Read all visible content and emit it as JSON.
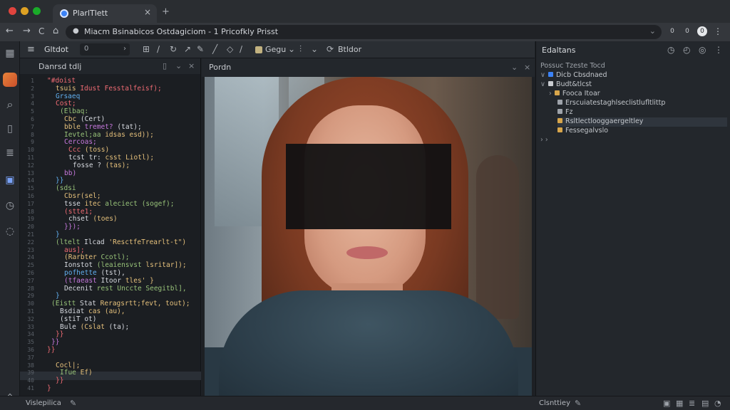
{
  "browser": {
    "tab_title": "PlarlTlett",
    "tab_close": "×",
    "new_tab": "+",
    "nav": {
      "back": "←",
      "forward": "→",
      "reload": "C",
      "home": "⌂"
    },
    "url": "Miacm Bsinabicos Ostdagiciom - 1 Pricofkly Prisst",
    "extensions": [
      "0",
      "0",
      "0",
      "⋮"
    ]
  },
  "activity_bar": {
    "icons": [
      "layout-icon",
      "avatar",
      "search-icon",
      "file-icon",
      "layers-icon",
      "image-icon",
      "history-icon",
      "settings-icon"
    ]
  },
  "toolbar": {
    "title": "Gltdot",
    "select_value": "0",
    "label_1": "Gegu",
    "label_2": "Btldor"
  },
  "code_panel": {
    "title": "Danrsd tdlj",
    "lines": [
      {
        "n": "1",
        "indent": 3,
        "parts": [
          [
            "c-red",
            "\"#doist"
          ]
        ]
      },
      {
        "n": "2",
        "indent": 5,
        "parts": [
          [
            "c-yellow",
            "tsuis "
          ],
          [
            "c-red",
            "Idust Fesstalfeisf);"
          ]
        ]
      },
      {
        "n": "3",
        "indent": 5,
        "parts": [
          [
            "c-blue",
            "Grsaeq"
          ]
        ]
      },
      {
        "n": "4",
        "indent": 5,
        "parts": [
          [
            "c-red",
            "Cost;"
          ]
        ]
      },
      {
        "n": "5",
        "indent": 6,
        "parts": [
          [
            "c-green",
            "(Elbaq:"
          ]
        ]
      },
      {
        "n": "6",
        "indent": 7,
        "parts": [
          [
            "c-yellow",
            "Cbc "
          ],
          [
            "c-white",
            "(Cert)"
          ]
        ]
      },
      {
        "n": "7",
        "indent": 7,
        "parts": [
          [
            "c-yellow",
            "bble "
          ],
          [
            "c-purple",
            "tremet? "
          ],
          [
            "c-white",
            "(tat);"
          ]
        ]
      },
      {
        "n": "8",
        "indent": 7,
        "parts": [
          [
            "c-green",
            "Ievtel;aa "
          ],
          [
            "c-yellow",
            "idsas esd));"
          ]
        ]
      },
      {
        "n": "9",
        "indent": 7,
        "parts": [
          [
            "c-purple",
            "Cercoas;"
          ]
        ]
      },
      {
        "n": "10",
        "indent": 8,
        "parts": [
          [
            "c-red",
            "Ccc "
          ],
          [
            "c-yellow",
            "(toss)"
          ]
        ]
      },
      {
        "n": "11",
        "indent": 8,
        "parts": [
          [
            "c-white",
            "tcst tr: "
          ],
          [
            "c-yellow",
            "csst Liotl);"
          ]
        ]
      },
      {
        "n": "12",
        "indent": 9,
        "parts": [
          [
            "c-white",
            "fosse ? "
          ],
          [
            "c-yellow",
            "(tas);"
          ]
        ]
      },
      {
        "n": "13",
        "indent": 7,
        "parts": [
          [
            "c-purple",
            "bb)"
          ]
        ]
      },
      {
        "n": "14",
        "indent": 5,
        "parts": [
          [
            "c-blue",
            "}}"
          ]
        ]
      },
      {
        "n": "15",
        "indent": 5,
        "parts": [
          [
            "c-green",
            "(sdsi"
          ]
        ]
      },
      {
        "n": "16",
        "indent": 7,
        "parts": [
          [
            "c-yellow",
            "Cbsr(sel;"
          ]
        ]
      },
      {
        "n": "17",
        "indent": 7,
        "parts": [
          [
            "c-white",
            "tsse "
          ],
          [
            "c-yellow",
            "itec "
          ],
          [
            "c-green",
            "aleciect (sogef);"
          ]
        ]
      },
      {
        "n": "18",
        "indent": 7,
        "parts": [
          [
            "c-red",
            "(stte1;"
          ]
        ]
      },
      {
        "n": "19",
        "indent": 8,
        "parts": [
          [
            "c-white",
            "chset "
          ],
          [
            "c-yellow",
            "(toes)"
          ]
        ]
      },
      {
        "n": "20",
        "indent": 7,
        "parts": [
          [
            "c-purple",
            "}});"
          ]
        ]
      },
      {
        "n": "21",
        "indent": 5,
        "parts": [
          [
            "c-blue",
            "}"
          ]
        ]
      },
      {
        "n": "22",
        "indent": 5,
        "parts": [
          [
            "c-green",
            "(ltelt "
          ],
          [
            "c-white",
            "Ilcad "
          ],
          [
            "c-yellow",
            "'ResctfeTrearlt-t\")"
          ]
        ]
      },
      {
        "n": "23",
        "indent": 7,
        "parts": [
          [
            "c-red",
            "aus];"
          ]
        ]
      },
      {
        "n": "24",
        "indent": 7,
        "parts": [
          [
            "c-yellow",
            "(Rarbter "
          ],
          [
            "c-green",
            "Ccotl);"
          ]
        ]
      },
      {
        "n": "25",
        "indent": 7,
        "parts": [
          [
            "c-white",
            "Ionstot "
          ],
          [
            "c-green",
            "(leaiensvst "
          ],
          [
            "c-yellow",
            "lsritar]);"
          ]
        ]
      },
      {
        "n": "26",
        "indent": 7,
        "parts": [
          [
            "c-blue",
            "pofhette "
          ],
          [
            "c-white",
            "(tst),"
          ]
        ]
      },
      {
        "n": "27",
        "indent": 7,
        "parts": [
          [
            "c-purple",
            "(tfaeast "
          ],
          [
            "c-white",
            "Itoor "
          ],
          [
            "c-yellow",
            "tles' }"
          ]
        ]
      },
      {
        "n": "28",
        "indent": 7,
        "parts": [
          [
            "c-white",
            "Decenit "
          ],
          [
            "c-green",
            "rest Unccte Seegitbl],"
          ]
        ]
      },
      {
        "n": "29",
        "indent": 5,
        "parts": [
          [
            "c-blue",
            "}"
          ]
        ]
      },
      {
        "n": "30",
        "indent": 4,
        "parts": [
          [
            "c-green",
            "(Eistt "
          ],
          [
            "c-white",
            "Stat "
          ],
          [
            "c-yellow",
            "Reragsrtt;fevt, tout);"
          ]
        ]
      },
      {
        "n": "31",
        "indent": 6,
        "parts": [
          [
            "c-white",
            "Bsdiat "
          ],
          [
            "c-yellow",
            "cas (au),"
          ]
        ]
      },
      {
        "n": "32",
        "indent": 6,
        "parts": [
          [
            "c-white",
            "(stiT ot)"
          ]
        ]
      },
      {
        "n": "33",
        "indent": 6,
        "parts": [
          [
            "c-white",
            "Bule "
          ],
          [
            "c-yellow",
            "(Cslat "
          ],
          [
            "c-white",
            "(ta);"
          ]
        ]
      },
      {
        "n": "34",
        "indent": 5,
        "parts": [
          [
            "c-red",
            "}}"
          ]
        ]
      },
      {
        "n": "35",
        "indent": 4,
        "parts": [
          [
            "c-purple",
            "}}"
          ]
        ]
      },
      {
        "n": "36",
        "indent": 3,
        "parts": [
          [
            "c-red",
            "}}"
          ]
        ]
      },
      {
        "n": "37",
        "indent": 0,
        "parts": [
          [
            "c-white",
            " "
          ]
        ]
      },
      {
        "n": "38",
        "indent": 5,
        "parts": [
          [
            "c-yellow",
            "Cocl|;"
          ]
        ]
      },
      {
        "n": "39",
        "indent": 6,
        "parts": [
          [
            "c-green",
            "Ifue "
          ],
          [
            "c-yellow",
            "Ef)"
          ]
        ]
      },
      {
        "n": "40",
        "indent": 5,
        "parts": [
          [
            "c-red",
            "}}"
          ]
        ]
      },
      {
        "n": "41",
        "indent": 3,
        "parts": [
          [
            "c-red",
            "}"
          ]
        ]
      }
    ]
  },
  "preview_panel": {
    "title": "Pordn"
  },
  "side_panel": {
    "title": "Edaltans",
    "subtitle": "Possuc   Tzeste Tocd",
    "tree": [
      {
        "label": "Dicb Cbsdnaed",
        "depth": 0,
        "chev": "∨",
        "color": "#3b82f6",
        "sel": false
      },
      {
        "label": "Budt&tlcst",
        "depth": 0,
        "chev": "∨",
        "color": "#c9ccd1",
        "sel": false
      },
      {
        "label": "Fooca Itoar",
        "depth": 1,
        "chev": "›",
        "color": "#d8a64b",
        "sel": false
      },
      {
        "label": "Erscuiatestaghlseclistlufltlittp",
        "depth": 2,
        "chev": "",
        "color": "#9ea3aa",
        "sel": false
      },
      {
        "label": "Fz",
        "depth": 2,
        "chev": "",
        "color": "#9ea3aa",
        "sel": false
      },
      {
        "label": "Rsltlectlooggaergeltley",
        "depth": 2,
        "chev": "",
        "color": "#d8a64b",
        "sel": true
      },
      {
        "label": "Fessegalvslo",
        "depth": 2,
        "chev": "",
        "color": "#d8a64b",
        "sel": false
      },
      {
        "label": "",
        "depth": 0,
        "chev": "› ›",
        "color": "",
        "sel": false
      }
    ]
  },
  "status_bar": {
    "left": "Vislepilica",
    "right": "Clsnttiey"
  }
}
